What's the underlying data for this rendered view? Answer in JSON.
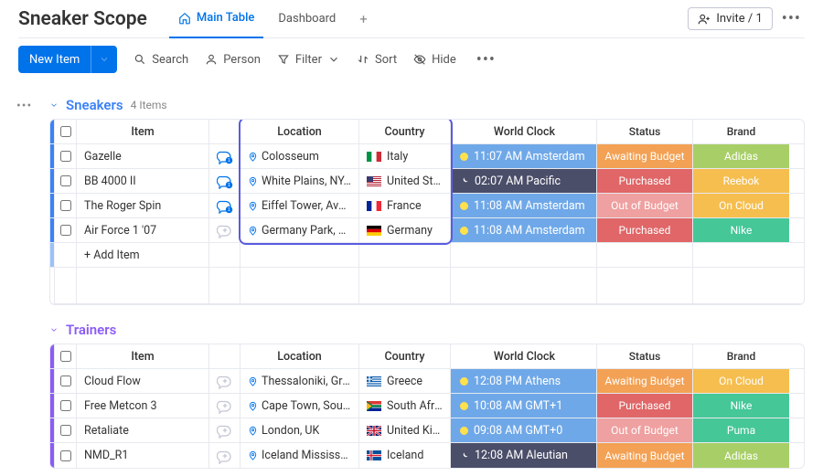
{
  "header": {
    "title": "Sneaker Scope",
    "tabs": [
      {
        "label": "Main Table",
        "active": true
      },
      {
        "label": "Dashboard",
        "active": false
      }
    ],
    "invite_label": "Invite / 1"
  },
  "toolbar": {
    "new_item": "New Item",
    "search": "Search",
    "person": "Person",
    "filter": "Filter",
    "sort": "Sort",
    "hide": "Hide"
  },
  "columns": {
    "item": "Item",
    "location": "Location",
    "country": "Country",
    "world_clock": "World Clock",
    "status": "Status",
    "brand": "Brand"
  },
  "add_item": "+ Add Item",
  "colors": {
    "status": {
      "Awaiting Budget": "#f3a154",
      "Purchased": "#e06667",
      "Out of Budget": "#efa0a0"
    },
    "brand": {
      "Adidas": "#a8cf67",
      "Reebok": "#f6be4f",
      "On Cloud": "#f6be4f",
      "Nike": "#45c798",
      "Puma": "#45c798"
    },
    "clock": {
      "day": "#6fa8e8",
      "night": "#4b4e69"
    },
    "groups": {
      "sneakers": "#3b82f6",
      "trainers": "#8b5cf6"
    }
  },
  "groups": [
    {
      "key": "sneakers",
      "title": "Sneakers",
      "count": "4 Items",
      "color": "#3b82f6",
      "rows": [
        {
          "name": "Gazelle",
          "thread": "active-badge",
          "location": "Colosseum",
          "country": "Italy",
          "flag": "it",
          "clock": "11:07 AM Amsterdam",
          "clock_mode": "day",
          "status": "Awaiting Budget",
          "brand": "Adidas"
        },
        {
          "name": "BB 4000 II",
          "thread": "active-badge",
          "location": "White Plains, NY, USA",
          "country": "United State...",
          "flag": "us",
          "clock": "02:07 AM Pacific",
          "clock_mode": "night",
          "status": "Purchased",
          "brand": "Reebok"
        },
        {
          "name": "The Roger Spin",
          "thread": "active-badge",
          "location": "Eiffel Tower, Avenue...",
          "country": "France",
          "flag": "fr",
          "clock": "11:08 AM Amsterdam",
          "clock_mode": "day",
          "status": "Out of Budget",
          "brand": "On Cloud"
        },
        {
          "name": "Air Force 1 '07",
          "thread": "plus",
          "location": "Germany Park, Lom...",
          "country": "Germany",
          "flag": "de",
          "clock": "11:08 AM Amsterdam",
          "clock_mode": "day",
          "status": "Purchased",
          "brand": "Nike"
        }
      ]
    },
    {
      "key": "trainers",
      "title": "Trainers",
      "count": "",
      "color": "#8b5cf6",
      "rows": [
        {
          "name": "Cloud Flow",
          "thread": "plus",
          "location": "Thessaloniki, Greece",
          "country": "Greece",
          "flag": "gr",
          "clock": "12:08 PM Athens",
          "clock_mode": "day",
          "status": "Awaiting Budget",
          "brand": "On Cloud"
        },
        {
          "name": "Free Metcon 3",
          "thread": "plus",
          "location": "Cape Town, South A...",
          "country": "South Africa",
          "flag": "za",
          "clock": "10:08 AM GMT+1",
          "clock_mode": "day",
          "status": "Purchased",
          "brand": "Nike"
        },
        {
          "name": "Retaliate",
          "thread": "plus",
          "location": "London, UK",
          "country": "United Kingd...",
          "flag": "uk",
          "clock": "09:08 AM GMT+0",
          "clock_mode": "day",
          "status": "Out of Budget",
          "brand": "Puma"
        },
        {
          "name": "NMD_R1",
          "thread": "plus",
          "location": "Iceland Mississauga,...",
          "country": "Iceland",
          "flag": "is",
          "clock": "12:08 AM Aleutian",
          "clock_mode": "night",
          "status": "Awaiting Budget",
          "brand": "Adidas"
        }
      ]
    }
  ]
}
